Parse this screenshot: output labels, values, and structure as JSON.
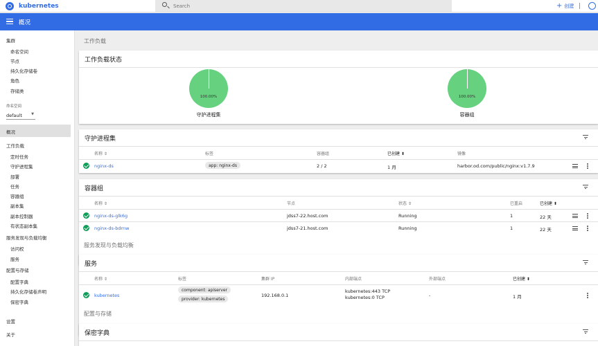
{
  "app": {
    "brand": "kubernetes",
    "search_placeholder": "Search",
    "create_label": "创建"
  },
  "bar": {
    "title": "概况"
  },
  "sidebar": {
    "cluster": "集群",
    "cluster_items": [
      "命名空间",
      "节点",
      "持久化存储卷",
      "角色",
      "存储类"
    ],
    "namespace_label": "命名空间",
    "namespace_value": "default",
    "overview": "概况",
    "workloads": "工作负载",
    "workload_items": [
      "定时任务",
      "守护进程集",
      "部署",
      "任务",
      "容器组",
      "副本集",
      "副本控制器",
      "有状态副本集"
    ],
    "discovery": "服务发现与负载均衡",
    "discovery_items": [
      "访问权",
      "服务"
    ],
    "config": "配置与存储",
    "config_items": [
      "配置字典",
      "持久化存储卷声明",
      "保密字典"
    ],
    "settings": "设置",
    "about": "关于"
  },
  "main": {
    "workloads_section": "工作负载",
    "status_card": {
      "title": "工作负载状态",
      "charts": [
        {
          "label": "守护进程集",
          "value": "100.00%"
        },
        {
          "label": "容器组",
          "value": "100.00%"
        }
      ]
    },
    "daemonsets": {
      "title": "守护进程集",
      "columns": [
        "名称",
        "标签",
        "容器组",
        "已创建",
        "镜像"
      ],
      "rows": [
        {
          "name": "nginx-ds",
          "label": "app: nginx-ds",
          "pods": "2 / 2",
          "created": "1 月",
          "image": "harbor.od.com/public/nginx:v1.7.9"
        }
      ]
    },
    "pods": {
      "title": "容器组",
      "columns": [
        "名称",
        "节点",
        "状态",
        "已重启",
        "已创建"
      ],
      "rows": [
        {
          "name": "nginx-ds-glk6g",
          "node": "jdss7-22.host.com",
          "status": "Running",
          "restarts": "1",
          "created": "22 天"
        },
        {
          "name": "nginx-ds-bdrnw",
          "node": "jdss7-21.host.com",
          "status": "Running",
          "restarts": "1",
          "created": "22 天"
        }
      ]
    },
    "discovery_section": "服务发现与负载均衡",
    "services": {
      "title": "服务",
      "columns": [
        "名称",
        "标签",
        "集群 IP",
        "内部端点",
        "外部端点",
        "已创建"
      ],
      "rows": [
        {
          "name": "kubernetes",
          "labels": [
            "component: apiserver",
            "provider: kubernetes"
          ],
          "cluster_ip": "192.168.0.1",
          "internal": [
            "kubernetes:443 TCP",
            "kubernetes:0 TCP"
          ],
          "external": "-",
          "created": "1 月"
        }
      ]
    },
    "config_section": "配置与存储",
    "secrets": {
      "title": "保密字典"
    }
  },
  "colors": {
    "primary": "#326ce5",
    "success": "#0f9d58",
    "chart": "#66d17e"
  }
}
